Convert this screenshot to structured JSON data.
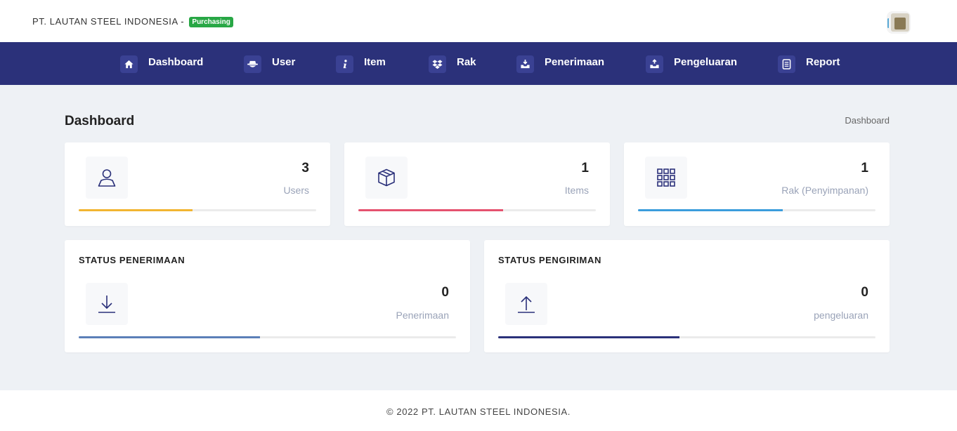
{
  "header": {
    "company": "PT. LAUTAN STEEL INDONESIA -",
    "role_badge": "Purchasing"
  },
  "nav": [
    {
      "label": "Dashboard",
      "icon": "home-icon"
    },
    {
      "label": "User",
      "icon": "user-icon"
    },
    {
      "label": "Item",
      "icon": "info-icon"
    },
    {
      "label": "Rak",
      "icon": "dropbox-icon"
    },
    {
      "label": "Penerimaan",
      "icon": "inbox-in-icon"
    },
    {
      "label": "Pengeluaran",
      "icon": "inbox-out-icon"
    },
    {
      "label": "Report",
      "icon": "report-icon"
    }
  ],
  "page": {
    "title": "Dashboard",
    "breadcrumb": "Dashboard"
  },
  "stats": [
    {
      "value": "3",
      "label": "Users",
      "icon": "user-outline-icon",
      "progress": 0.48,
      "color": "#f2b531"
    },
    {
      "value": "1",
      "label": "Items",
      "icon": "box-icon",
      "progress": 0.61,
      "color": "#e5526f"
    },
    {
      "value": "1",
      "label": "Rak (Penyimpanan)",
      "icon": "grid-icon",
      "progress": 0.61,
      "color": "#3b9ddc"
    }
  ],
  "status": [
    {
      "title": "STATUS PENERIMAAN",
      "value": "0",
      "label": "Penerimaan",
      "icon": "download-icon",
      "progress": 0.48,
      "color": "#5b7fb8"
    },
    {
      "title": "STATUS PENGIRIMAN",
      "value": "0",
      "label": "pengeluaran",
      "icon": "upload-icon",
      "progress": 0.48,
      "color": "#2b317a"
    }
  ],
  "footer": {
    "text": "© 2022 PT. LAUTAN STEEL INDONESIA."
  }
}
